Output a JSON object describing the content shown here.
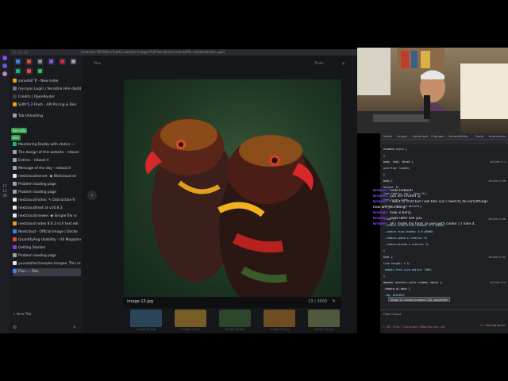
{
  "browser": {
    "url": "localhost:3000/files?path=/sample-images/%2Fdocs&sort=name&filt=random&view=grid"
  },
  "rail": {
    "time": "17\n13\n39",
    "dots": [
      "#9146ff",
      "#6a5acd",
      "#c586c0"
    ]
  },
  "sidebar": {
    "pinned_colors": [
      "#3b82f6",
      "#e34c26",
      "#7f8c9a",
      "#7f52ff",
      "#e11d48",
      "#9ca3af",
      "#10b981",
      "#ef4444",
      "#22c55e"
    ],
    "items": [
      {
        "label": "sanodolf Tr - New order",
        "color": "#f59e0b"
      },
      {
        "label": "my-zyan Login | Versatile Hire dashbo",
        "color": "#6b7280"
      },
      {
        "label": "Credits | OpenRouter",
        "color": "#374151"
      },
      {
        "label": "SUM 5.3 Flash - API Pricing & Ben",
        "color": "#f59e0b"
      },
      {
        "label": "Tab Unloading",
        "color": "#9ca3af"
      },
      {
        "label": "Monitoring Daddy with statics —",
        "color": "#10b981"
      },
      {
        "label": "The design of this website - reboot",
        "color": "#9ca3af"
      },
      {
        "label": "Entries - reboot.it",
        "color": "#9ca3af"
      },
      {
        "label": "Message of the day - reboot.it",
        "color": "#9ca3af"
      },
      {
        "label": "nextcloud/server: ◆ Nextcloud se",
        "color": "#e5e7eb"
      },
      {
        "label": "Problem loading page",
        "color": "#9ca3af"
      },
      {
        "label": "Problem loading page",
        "color": "#9ca3af"
      },
      {
        "label": "nextcloud/notes: ✎ Distraction-fr",
        "color": "#e5e7eb"
      },
      {
        "label": "nextcloud/text at v16.8.3",
        "color": "#e5e7eb"
      },
      {
        "label": "nextcloud/viewer: ◆ Simple file vi",
        "color": "#e5e7eb"
      },
      {
        "label": "nextcloud notes 8.6.3 rich text edi",
        "color": "#f59e0b"
      },
      {
        "label": "Nextcloud - Official Image | Docke",
        "color": "#3b82f6"
      },
      {
        "label": "QuantifyAng Usability - UX Magazine",
        "color": "#ef4444"
      },
      {
        "label": "Getting Started",
        "color": "#7c3aed"
      },
      {
        "label": "Problem loading page",
        "color": "#9ca3af"
      },
      {
        "label": "yuvuzsther/sampler-images: This re",
        "color": "#e5e7eb"
      },
      {
        "label": "Files — files",
        "color": "#3b82f6"
      }
    ],
    "tag_security": "Security",
    "tag_dev": "Dev",
    "new_tab": "New Tab"
  },
  "viewer": {
    "title": "files",
    "trash": "Trash",
    "close": "×",
    "prev": "‹",
    "image_name": "image-13.jpg",
    "counter": "13 / 2000",
    "thumbs": [
      {
        "label": "image-30.jpg",
        "color": "#3b6a8c"
      },
      {
        "label": "image-31.jpg",
        "color": "#c8952f"
      },
      {
        "label": "image-32.jpg",
        "color": "#3f6b3a"
      },
      {
        "label": "image-33.jpg",
        "color": "#b9782a"
      },
      {
        "label": "image-34.jpg",
        "color": "#7d8f5a"
      }
    ]
  },
  "devtools": {
    "tabs": [
      "Notes",
      "Layout",
      "Computed",
      "Changes",
      "Compatibility",
      "Fonts",
      "Animations"
    ],
    "code_lines": [
      {
        "text": "element.style {",
        "src": ""
      },
      {
        "text": "}",
        "src": ""
      },
      {
        "text": "body, html, #root {",
        "src": "inline:1:1"
      },
      {
        "text": "  overflow: hidden;",
        "src": ""
      },
      {
        "text": "}",
        "src": ""
      },
      {
        "text": "body {",
        "src": "inline:1:10"
      },
      {
        "text": "  margin: 0;",
        "src": ""
      },
      {
        "text": "  font-family: var(--font-ff);",
        "src": ""
      },
      {
        "text": "  font-size: 1rem;",
        "src": ""
      },
      {
        "text": "  color: var(--on-default);",
        "src": ""
      },
      {
        "text": "}",
        "src": ""
      },
      {
        "text": ":root {",
        "src": "inline:1:36"
      },
      {
        "text": "  --chakra-ring-offset-shadow: 0 0 #0000;",
        "src": ""
      },
      {
        "text": "  --chakra-ring-shadow: 0 0 #0000;",
        "src": ""
      },
      {
        "text": "  --chakra-space-x-reverse: 0;",
        "src": ""
      },
      {
        "text": "  --chakra-divide-x-reverse: 0;",
        "src": ""
      },
      {
        "text": "}",
        "src": ""
      },
      {
        "text": "html {",
        "src": "inline:1:12"
      },
      {
        "text": "  line-height: 1.5;",
        "src": ""
      },
      {
        "text": "  -webkit-text-size-adjust: 100%;",
        "src": ""
      },
      {
        "text": "}",
        "src": ""
      },
      {
        "text": "@media (prefers-color-scheme: dark) {",
        "src": "inline:1:4"
      },
      {
        "text": "  .chakra-ui-dark {",
        "src": ""
      },
      {
        "text": "    --bg: #1A202C;",
        "src": ""
      }
    ],
    "tooltip": "Show 12 unused custom CSS properties",
    "console_label": "Filter Output",
    "console_line": "▸ GET http://localhost:3000/favicon.ico",
    "badges": "1 ⨯ 404  Not found"
  },
  "chat": [
    {
      "user": "krisbez:",
      "msg": "hello Reboot!"
    },
    {
      "user": "krisbez:",
      "msg": "you are invited 😊"
    },
    {
      "user": "krisbez:",
      "msg": "I want to chat but I will talk cuz I need to do somethings"
    },
    {
      "user": "",
      "msg": "how are you doing"
    },
    {
      "user": "krisbez:",
      "msg": "how is berry"
    },
    {
      "user": "krisbez:",
      "msg": "peak later see you"
    },
    {
      "user": "krisbez:",
      "msg": "ah I made my tools as well with codex ;) I love it."
    }
  ],
  "colors": {
    "accent": "#3b82f6",
    "security_tag": "#2e9c48",
    "dev_tag": "#2e9c48",
    "chat_user": "#9146ff"
  }
}
